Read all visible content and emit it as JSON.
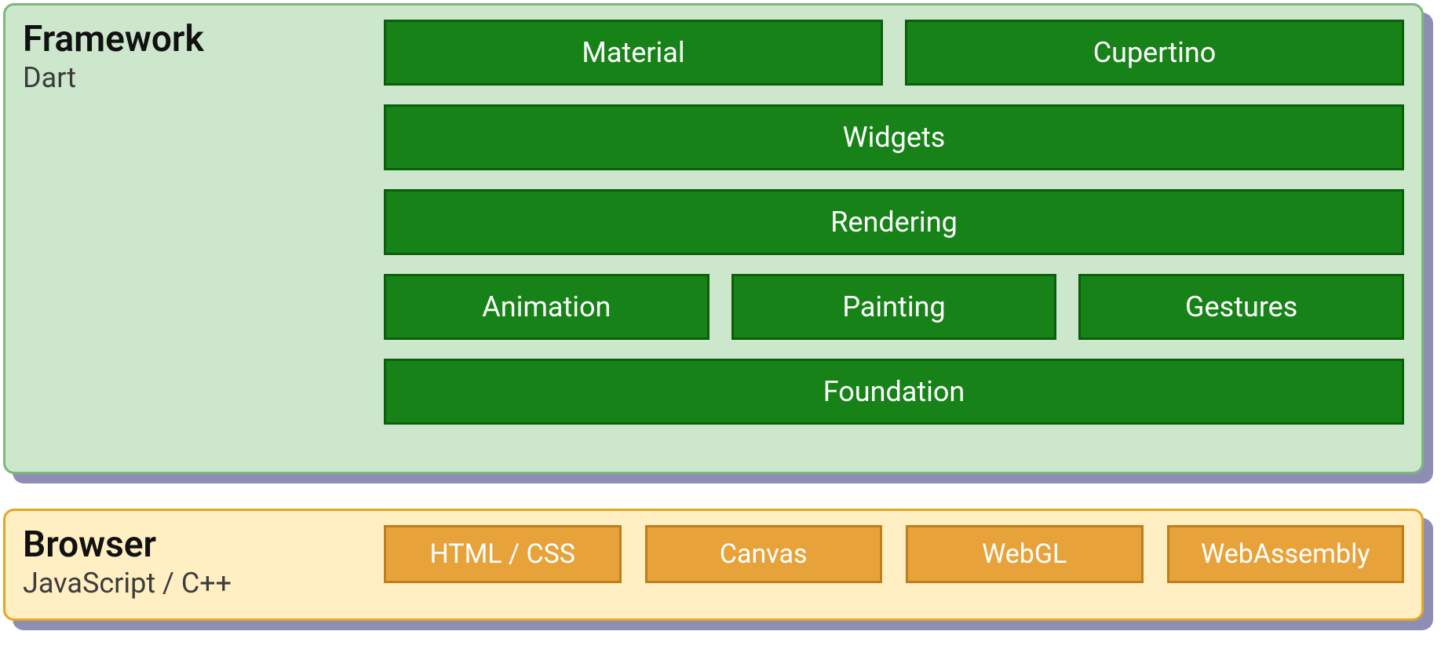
{
  "framework": {
    "title": "Framework",
    "subtitle": "Dart",
    "rows": [
      [
        "Material",
        "Cupertino"
      ],
      [
        "Widgets"
      ],
      [
        "Rendering"
      ],
      [
        "Animation",
        "Painting",
        "Gestures"
      ],
      [
        "Foundation"
      ]
    ]
  },
  "browser": {
    "title": "Browser",
    "subtitle": "JavaScript / C++",
    "rows": [
      [
        "HTML / CSS",
        "Canvas",
        "WebGL",
        "WebAssembly"
      ]
    ]
  }
}
